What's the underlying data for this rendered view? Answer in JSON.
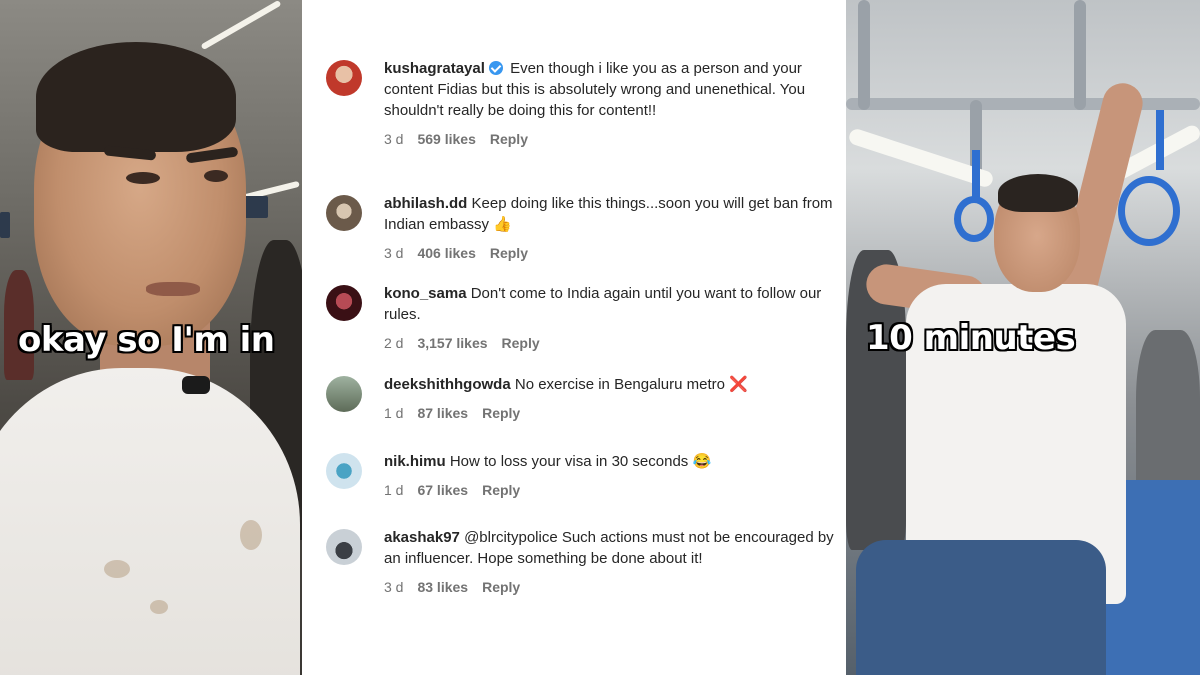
{
  "left_frame": {
    "caption": "okay so I'm in"
  },
  "right_frame": {
    "caption": "10 minutes"
  },
  "comments": [
    {
      "username": "kushagratayal",
      "verified": true,
      "text": "Even though i like you as a person and your content Fidias but this is absolutely wrong and unenethical. You shouldn't really be doing this for content!!",
      "age": "3 d",
      "likes": "569 likes",
      "reply": "Reply",
      "avatar_color": "#c0392b"
    },
    {
      "username": "abhilash.dd",
      "verified": false,
      "text": "Keep doing like this things...soon you will get ban from Indian embassy 👍",
      "age": "3 d",
      "likes": "406 likes",
      "reply": "Reply",
      "avatar_color": "#6b5a4a"
    },
    {
      "username": "kono_sama",
      "verified": false,
      "text": "Don't come to India again until you want to follow our rules.",
      "age": "2 d",
      "likes": "3,157 likes",
      "reply": "Reply",
      "avatar_color": "#7a1f2b"
    },
    {
      "username": "deekshithhgowda",
      "verified": false,
      "text": "No exercise in Bengaluru metro ❌",
      "age": "1 d",
      "likes": "87 likes",
      "reply": "Reply",
      "avatar_color": "#5d6b58"
    },
    {
      "username": "nik.himu",
      "verified": false,
      "text": "How to loss your visa in 30 seconds 😂",
      "age": "1 d",
      "likes": "67 likes",
      "reply": "Reply",
      "avatar_color": "#8fb3c9"
    },
    {
      "username": "akashak97",
      "verified": false,
      "text": "@blrcitypolice Such actions must not be encouraged by an influencer. Hope something be done about it!",
      "age": "3 d",
      "likes": "83 likes",
      "reply": "Reply",
      "avatar_color": "#9aa3ad"
    }
  ],
  "colors": {
    "text_primary": "#262626",
    "text_secondary": "#737373",
    "verified_blue": "#3897f0",
    "handle_blue": "#2f6fd0"
  }
}
